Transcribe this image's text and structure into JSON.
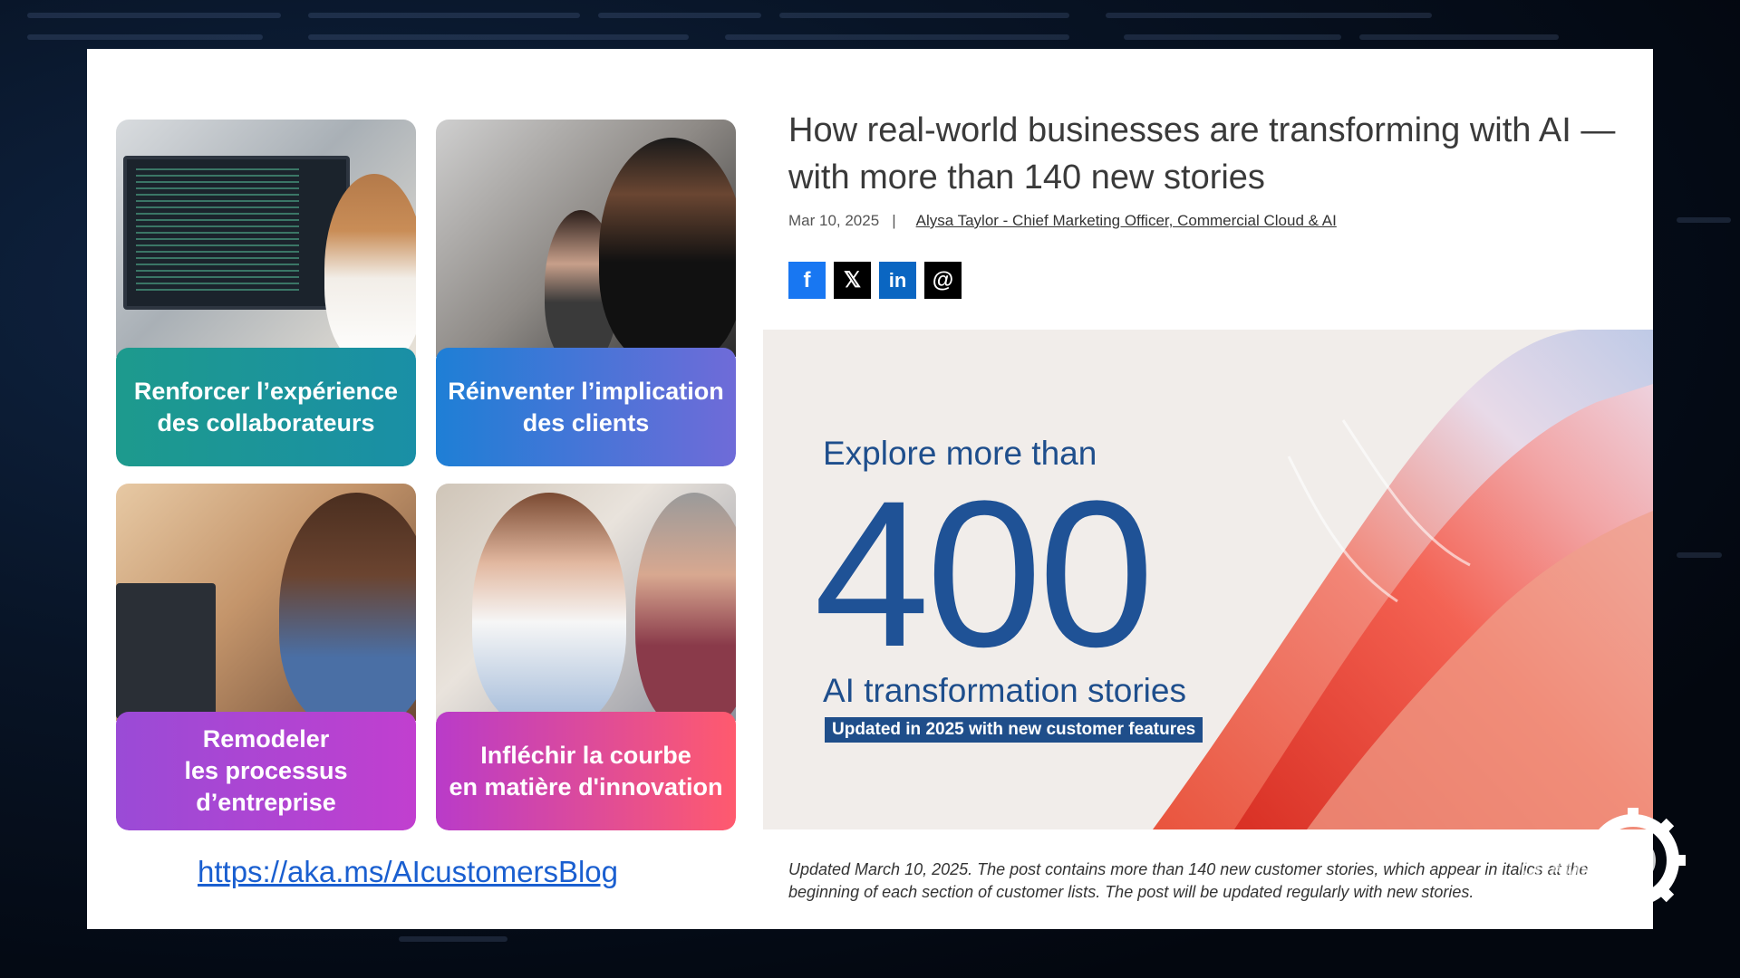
{
  "slide": {
    "tiles": [
      {
        "label": "Renforcer l’expérience\ndes collaborateurs"
      },
      {
        "label": "Réinventer l’implication\ndes clients"
      },
      {
        "label": "Remodeler\nles processus\nd’entreprise"
      },
      {
        "label": "Infléchir la courbe\nen matière d'innovation"
      }
    ],
    "link": "https://aka.ms/AIcustomersBlog"
  },
  "article": {
    "title": "How real-world businesses are transforming with AI — with more than 140 new stories",
    "date": "Mar 10, 2025",
    "separator": "|",
    "author": "Alysa Taylor - Chief Marketing Officer, Commercial Cloud & AI",
    "socials": [
      {
        "name": "facebook",
        "glyph": "f"
      },
      {
        "name": "x",
        "glyph": "𝕏"
      },
      {
        "name": "linkedin",
        "glyph": "in"
      },
      {
        "name": "threads",
        "glyph": "@"
      }
    ],
    "banner": {
      "explore": "Explore more than",
      "number": "400",
      "stories": "AI transformation stories",
      "badge": "Updated in 2025 with new customer features"
    },
    "note": "Updated March 10, 2025. The post contains more than 140 new customer stories, which appear in italics at the beginning of each section of customer lists. The post will be updated regularly with new stories."
  },
  "overlay_logo": {
    "text": "LES CHAMPS DE L'IA"
  },
  "colors": {
    "accent_blue": "#1f5296",
    "link_blue": "#1a5fd0"
  }
}
